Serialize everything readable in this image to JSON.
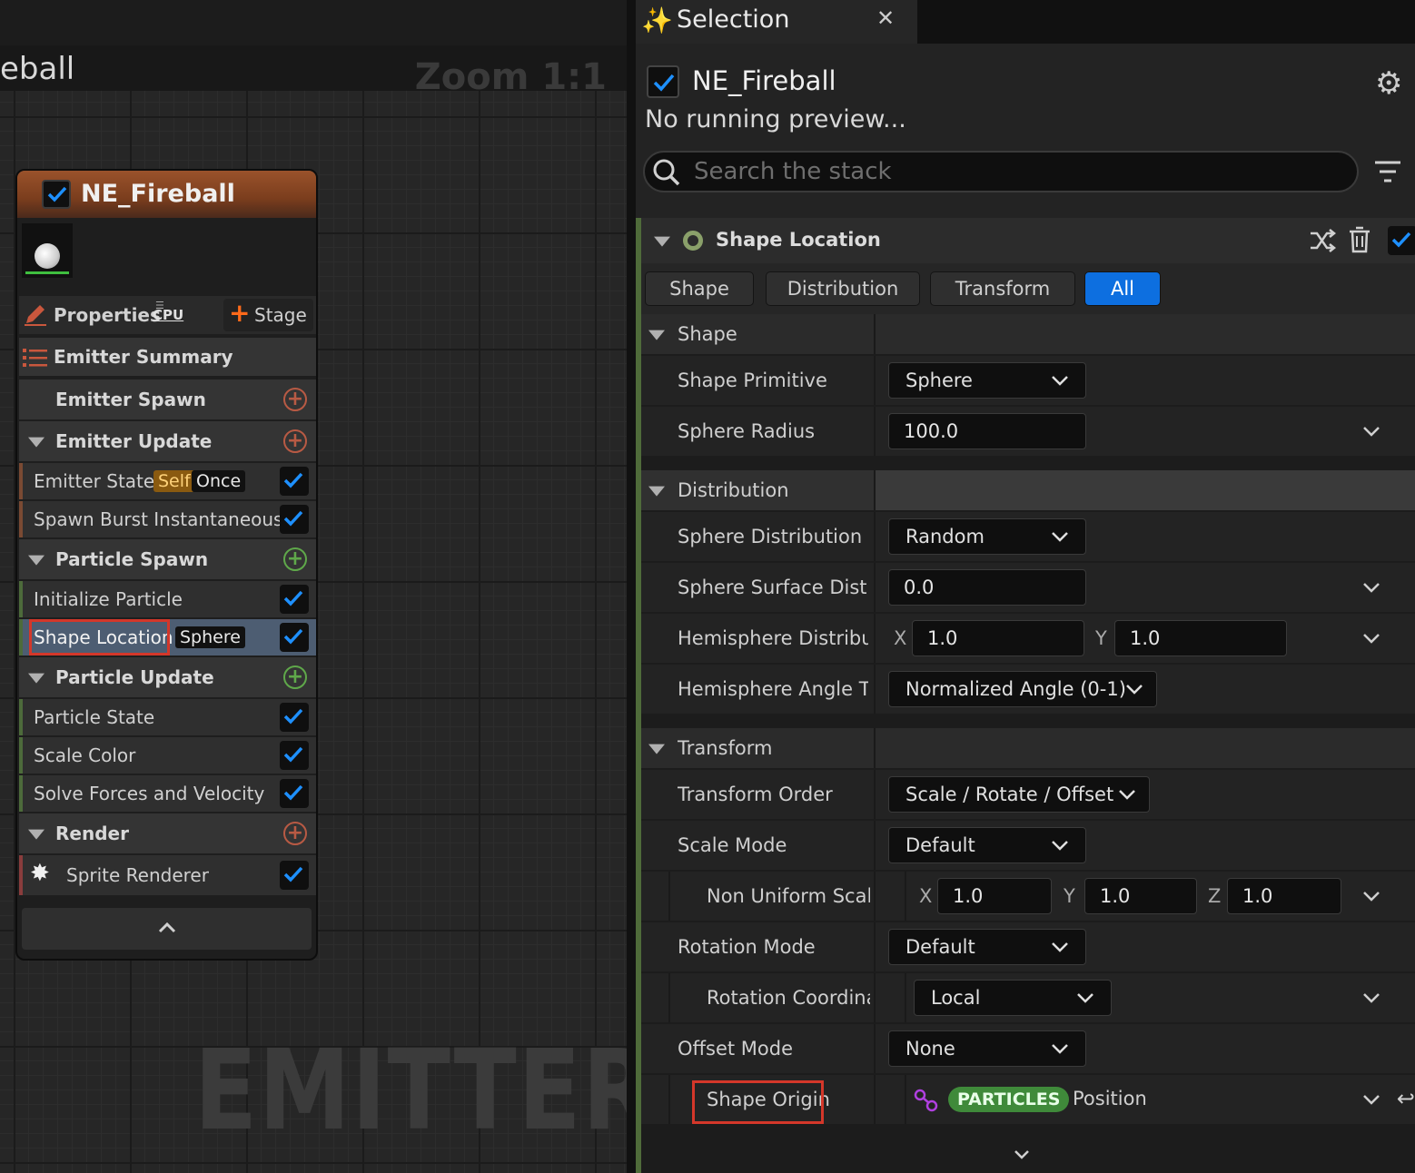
{
  "graph": {
    "title": "eball",
    "zoom": "Zoom 1:1",
    "watermark": "EMITTER"
  },
  "node": {
    "title": "NE_Fireball",
    "properties_label": "Properties",
    "cpu_label": "CPU",
    "stage_label": "Stage",
    "rows": [
      {
        "label": "Emitter Summary"
      },
      {
        "label": "Emitter Spawn"
      },
      {
        "label": "Emitter Update"
      },
      {
        "label": "Emitter State",
        "tag1": "Self",
        "tag2": "Once"
      },
      {
        "label": "Spawn Burst Instantaneous"
      },
      {
        "label": "Particle Spawn"
      },
      {
        "label": "Initialize Particle"
      },
      {
        "label": "Shape Location",
        "tag1": "Sphere"
      },
      {
        "label": "Particle Update"
      },
      {
        "label": "Particle State"
      },
      {
        "label": "Scale Color"
      },
      {
        "label": "Solve Forces and Velocity"
      },
      {
        "label": "Render"
      },
      {
        "label": "Sprite Renderer"
      }
    ]
  },
  "panel": {
    "tab_label": "Selection",
    "title": "NE_Fireball",
    "preview_text": "No running preview...",
    "search_placeholder": "Search the stack",
    "module_title": "Shape Location",
    "filters": [
      "Shape",
      "Distribution",
      "Transform",
      "All"
    ],
    "active_filter": "All",
    "categories": {
      "shape": "Shape",
      "distribution": "Distribution",
      "transform": "Transform"
    },
    "props": {
      "shape_primitive": {
        "name": "Shape Primitive",
        "value": "Sphere"
      },
      "sphere_radius": {
        "name": "Sphere Radius",
        "value": "100.0"
      },
      "sphere_distribution": {
        "name": "Sphere Distribution",
        "value": "Random"
      },
      "sphere_surface": {
        "name": "Sphere Surface Distrib",
        "value": "0.0"
      },
      "hemisphere_dist": {
        "name": "Hemisphere Distributi",
        "x": "1.0",
        "y": "1.0"
      },
      "hemisphere_angle": {
        "name": "Hemisphere Angle Typ",
        "value": "Normalized Angle (0-1)"
      },
      "transform_order": {
        "name": "Transform Order",
        "value": "Scale / Rotate / Offset"
      },
      "scale_mode": {
        "name": "Scale Mode",
        "value": "Default"
      },
      "non_uniform_scale": {
        "name": "Non Uniform Scale",
        "x": "1.0",
        "y": "1.0",
        "z": "1.0"
      },
      "rotation_mode": {
        "name": "Rotation Mode",
        "value": "Default"
      },
      "rotation_coord": {
        "name": "Rotation Coordinat",
        "value": "Local"
      },
      "offset_mode": {
        "name": "Offset Mode",
        "value": "None"
      },
      "shape_origin": {
        "name": "Shape Origin",
        "badge": "PARTICLES",
        "value": "Position"
      }
    },
    "axis_labels": {
      "x": "X",
      "y": "Y",
      "z": "Z"
    }
  },
  "colors": {
    "accent_blue": "#0d6fe0",
    "check_blue": "#1e90ff",
    "highlight_red": "#d4372a",
    "particles_green": "#3f8a3a",
    "self_tag": "#8a5a10"
  }
}
